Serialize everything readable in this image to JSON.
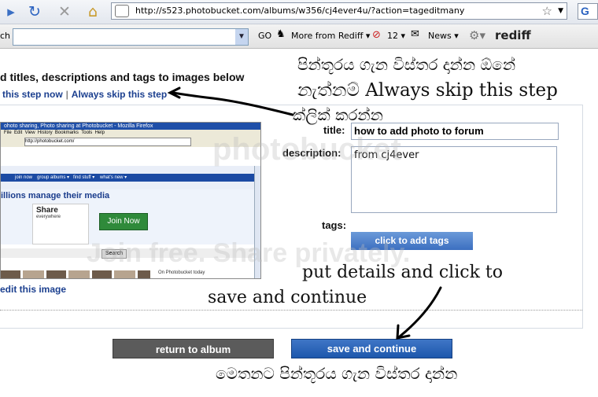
{
  "browser": {
    "url": "http://s523.photobucket.com/albums/w356/cj4ever4u/?action=tageditmany",
    "search_engine_initial": "G"
  },
  "toolbar": {
    "search_partial_label": "ch",
    "go_label": "GO",
    "more_from_label": "More from Rediff",
    "blocked_count": "12",
    "news_label": "News",
    "brand_label": "rediff"
  },
  "page": {
    "heading_partial": "d titles, descriptions and tags to images below",
    "skip_step_partial": "this step now",
    "skip_separator": "|",
    "always_skip_label": "Always skip this step",
    "form": {
      "title_label": "title:",
      "title_value": "how to add photo to forum",
      "description_label": "description:",
      "description_value": "from cj4ever",
      "tags_label": "tags:",
      "add_tags_button": "click to add tags"
    },
    "edit_image_partial": "edit this image",
    "return_button": "return to album",
    "save_button": "save and continue"
  },
  "thumbnail": {
    "title_partial": "ohoto sharing, Photo sharing at Photobucket - Mozilla Firefox",
    "headline_partial": "illions manage their media",
    "share_label": "Share",
    "share_sub": "everywhere",
    "join_now": "Join Now",
    "search_label": "Search",
    "on_photobucket": "On Photobucket today"
  },
  "annotations": {
    "top_line1": "පින්තූරය ගැන විස්තර දාන්න ඕනේ",
    "top_line2": "නැත්නම් Always skip this step",
    "top_line3": "ක්ලික් කරන්න",
    "middle_line1": "put  details  and click to",
    "middle_line2": "save and continue",
    "bottom_line": "මෙතනට පින්තූරය ගැන විස්තර දාන්න"
  },
  "watermark": {
    "logo_text": "photobucket",
    "tagline": "Join free. Share privately."
  },
  "colors": {
    "save_blue": "#1d57ac",
    "return_gray": "#5b5b5b",
    "link_blue": "#1b3f8f"
  }
}
